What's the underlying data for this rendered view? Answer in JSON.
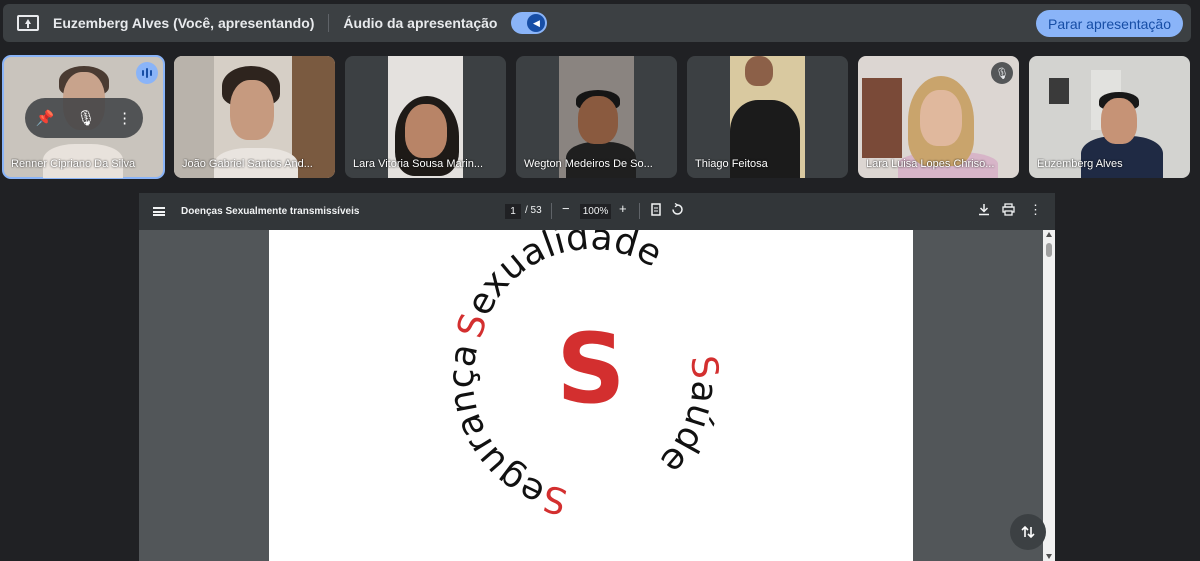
{
  "topbar": {
    "presenter_label": "Euzemberg Alves (Você, apresentando)",
    "audio_label": "Áudio da apresentação",
    "stop_button": "Parar apresentação"
  },
  "participants": [
    {
      "name": "Renner Cipriano Da Silva"
    },
    {
      "name": "João Gabriel Santos And..."
    },
    {
      "name": "Lara Vitoria Sousa Marin..."
    },
    {
      "name": "Wegton Medeiros De So..."
    },
    {
      "name": "Thiago Feitosa"
    },
    {
      "name": "Lara Luisa Lopes Chriso..."
    },
    {
      "name": "Euzemberg Alves"
    }
  ],
  "viewer": {
    "doc_title": "Doenças Sexualmente transmissíveis",
    "current_page": "1",
    "total_pages": "/ 53",
    "zoom": "100%",
    "zoom_out": "−",
    "zoom_in": "+"
  },
  "slide": {
    "word_sexualidade_initial": "S",
    "word_sexualidade_rest": "exualidade",
    "word_saude_initial": "S",
    "word_saude_rest": "aúde",
    "word_seguranca_initial": "S",
    "word_seguranca_rest": "egurança",
    "center_letter": "S",
    "accent_color": "#d32f2f"
  }
}
